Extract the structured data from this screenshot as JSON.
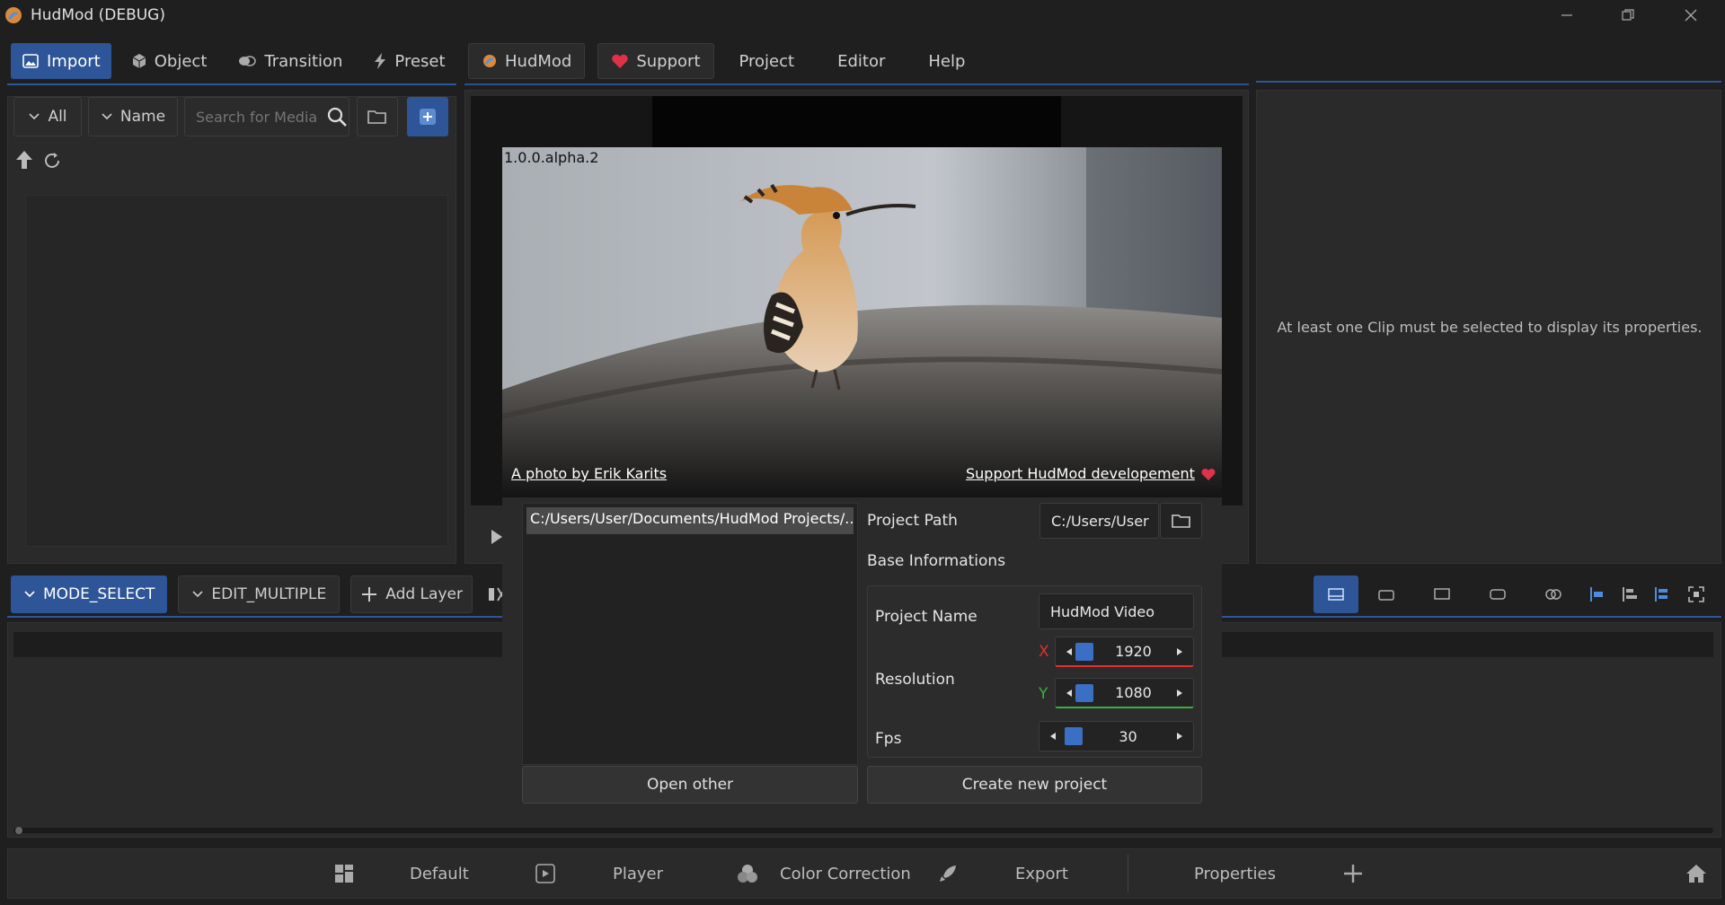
{
  "window": {
    "title": "HudMod (DEBUG)"
  },
  "left_tabs": [
    "Import",
    "Object",
    "Transition",
    "Preset"
  ],
  "top_menu": {
    "hudmod": "HudMod",
    "support": "Support",
    "project": "Project",
    "editor": "Editor",
    "help": "Help"
  },
  "media": {
    "filter_label": "All",
    "sort_label": "Name",
    "search_placeholder": "Search for Media"
  },
  "properties": {
    "empty_message": "At least one Clip must be selected to display its properties."
  },
  "timeline": {
    "mode_select": "MODE_SELECT",
    "edit_multiple": "EDIT_MULTIPLE",
    "add_layer": "Add Layer"
  },
  "bottom_bar": {
    "default": "Default",
    "player": "Player",
    "color_correction": "Color Correction",
    "export": "Export",
    "properties": "Properties"
  },
  "dialog": {
    "version": "1.0.0.alpha.2",
    "photo_credit": "A photo by Erik Karits",
    "support_link": "Support HudMod developement",
    "recent_projects": [
      "C:/Users/User/Documents/HudMod Projects/..."
    ],
    "project_path_label": "Project Path",
    "project_path_value": "C:/Users/User",
    "base_info_label": "Base Informations",
    "project_name_label": "Project Name",
    "project_name_value": "HudMod Video",
    "resolution_label": "Resolution",
    "res_x_label": "X",
    "res_x_value": "1920",
    "res_y_label": "Y",
    "res_y_value": "1080",
    "fps_label": "Fps",
    "fps_value": "30",
    "open_other": "Open other",
    "create_new": "Create new project"
  },
  "colors": {
    "accent": "#2d5597",
    "x_axis": "#e03030",
    "y_axis": "#3fae3f",
    "heart": "#e0314a"
  }
}
